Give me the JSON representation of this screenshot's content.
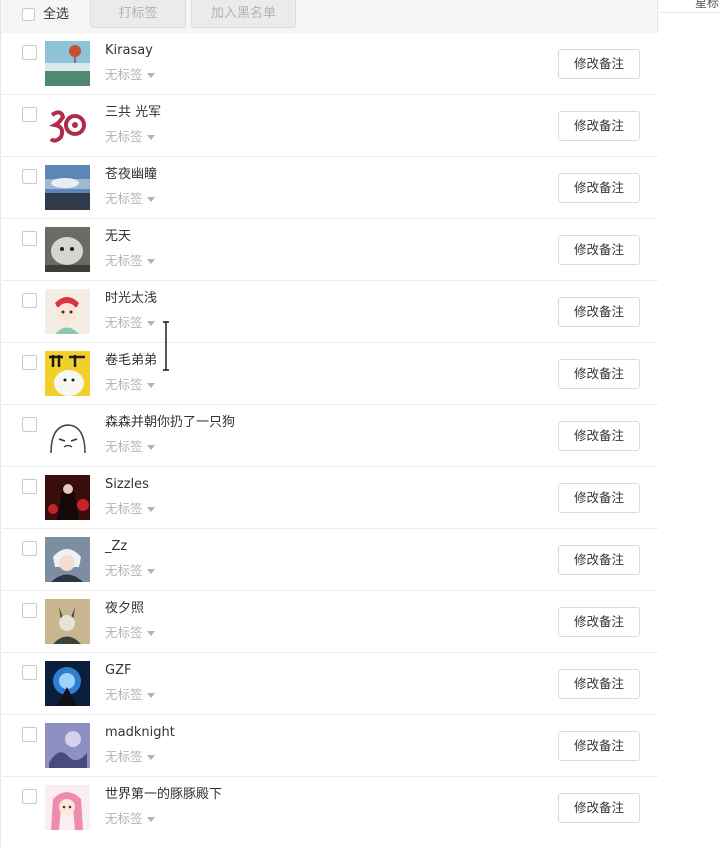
{
  "toolbar": {
    "select_all_label": "全选",
    "tag_button_label": "打标签",
    "blacklist_button_label": "加入黑名单"
  },
  "side": {
    "label": "星标"
  },
  "friends": [
    {
      "name": "Kirasay",
      "tag": "无标签",
      "remark_button": "修改备注"
    },
    {
      "name": "三共 光军",
      "tag": "无标签",
      "remark_button": "修改备注"
    },
    {
      "name": "苍夜幽瞳",
      "tag": "无标签",
      "remark_button": "修改备注"
    },
    {
      "name": "无天",
      "tag": "无标签",
      "remark_button": "修改备注"
    },
    {
      "name": "时光太浅",
      "tag": "无标签",
      "remark_button": "修改备注"
    },
    {
      "name": "卷毛弟弟",
      "tag": "无标签",
      "remark_button": "修改备注"
    },
    {
      "name": "森森并朝你扔了一只狗",
      "tag": "无标签",
      "remark_button": "修改备注"
    },
    {
      "name": "Sizzles",
      "tag": "无标签",
      "remark_button": "修改备注"
    },
    {
      "name": "_Zz",
      "tag": "无标签",
      "remark_button": "修改备注"
    },
    {
      "name": "夜夕照",
      "tag": "无标签",
      "remark_button": "修改备注"
    },
    {
      "name": "GZF",
      "tag": "无标签",
      "remark_button": "修改备注"
    },
    {
      "name": "madknight",
      "tag": "无标签",
      "remark_button": "修改备注"
    },
    {
      "name": "世界第一的豚豚殿下",
      "tag": "无标签",
      "remark_button": "修改备注"
    }
  ]
}
